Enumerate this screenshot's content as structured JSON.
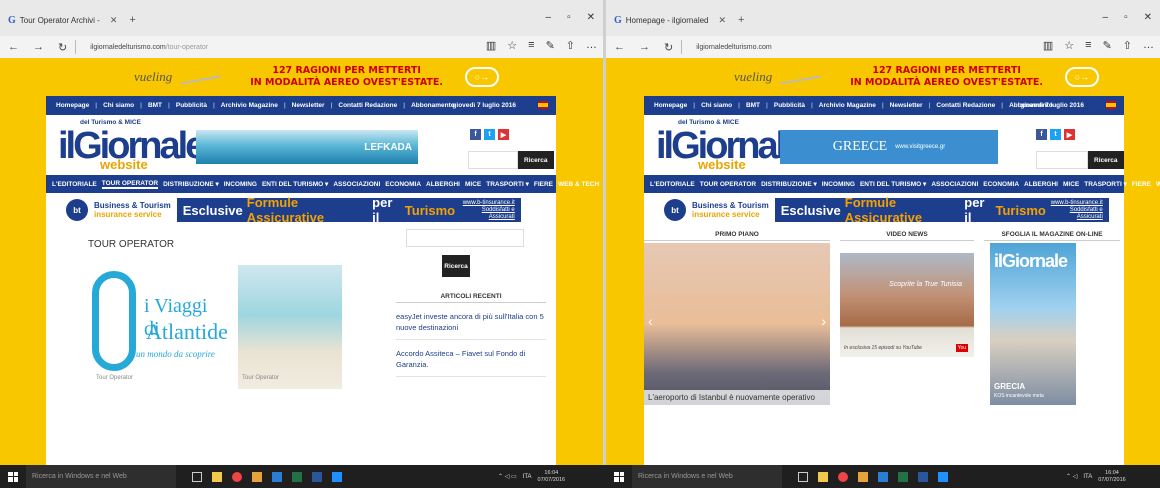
{
  "left_window": {
    "tab_title": "Tour Operator Archivi -",
    "url_domain": "ilgiornaledelturismo.com",
    "url_path": "/tour-operator"
  },
  "right_window": {
    "tab_title": "Homepage - ilgiornaled",
    "url_domain": "ilgiornaledelturismo.com"
  },
  "banner": {
    "brand": "vueling",
    "line1": "127 RAGIONI PER METTERTI",
    "line2": "IN MODALITÀ AEREO OVEST'ESTATE."
  },
  "topnav": {
    "items": [
      "Homepage",
      "Chi siamo",
      "BMT",
      "Pubblicità",
      "Archivio Magazine",
      "Newsletter",
      "Contatti Redazione",
      "Abbonamento"
    ],
    "date": "giovedì 7 luglio 2016"
  },
  "logo": {
    "subtitle": "del Turismo & MICE",
    "title": "ilGiornale",
    "website": "website"
  },
  "header_ads": {
    "left": "LEFKADA",
    "right_title": "GREECE",
    "right_url": "www.visitgreece.gr"
  },
  "search": {
    "button": "Ricerca"
  },
  "mainnav": {
    "items": [
      "L'EDITORIALE",
      "TOUR OPERATOR",
      "DISTRIBUZIONE ▾",
      "INCOMING",
      "ENTI DEL TURISMO ▾",
      "ASSOCIAZIONI",
      "ECONOMIA",
      "ALBERGHI",
      "MICE",
      "TRASPORTI ▾",
      "FIERE",
      "WEB & TECH"
    ]
  },
  "insurance": {
    "logo_line1": "Business & Tourism",
    "logo_line2": "insurance service",
    "text_a": "Esclusive",
    "text_b": "Formule Assicurative",
    "text_c": "per il",
    "text_d": "Turismo",
    "url": "www.b-tinsurance.it",
    "tagline": "Soddisfatti e Assicurati"
  },
  "tour_operator_page": {
    "section_title": "TOUR OPERATOR",
    "atlantide_1": "i Viaggi di",
    "atlantide_2": "Atlantide",
    "atlantide_3": "un mondo da scoprire",
    "tag_1": "Tour Operator",
    "tag_2": "Tour Operator",
    "sidebar_button": "Ricerca",
    "recent_heading": "ARTICOLI RECENTI",
    "recent_articles": [
      "easyJet investe ancora di più sull'Italia con 5 nuove destinazioni",
      "Accordo Assiteca – Fiavet sul Fondo di Garanzia."
    ]
  },
  "homepage": {
    "primo_piano": "PRIMO PIANO",
    "video_news": "VIDEO NEWS",
    "magazine": "SFOGLIA IL MAGAZINE ON-LINE",
    "headline": "L'aeroporto di Istanbul è nuovamente operativo",
    "video_title": "Scoprite la True Tunisia",
    "video_caption": "In esclusiva 15 episodi su YouTube",
    "youtube": "You",
    "magazine_title": "ilGiornale",
    "magazine_cover": "GRECIA",
    "magazine_cover_sub": "KOS incantevole meta"
  },
  "taskbar": {
    "search_placeholder": "Ricerca in Windows e nel Web",
    "lang": "ITA",
    "time": "16:04",
    "date": "07/07/2016"
  },
  "colors": {
    "site_yellow": "#f8c700",
    "nav_blue": "#1d3e8c",
    "accent_orange": "#f5a100"
  }
}
